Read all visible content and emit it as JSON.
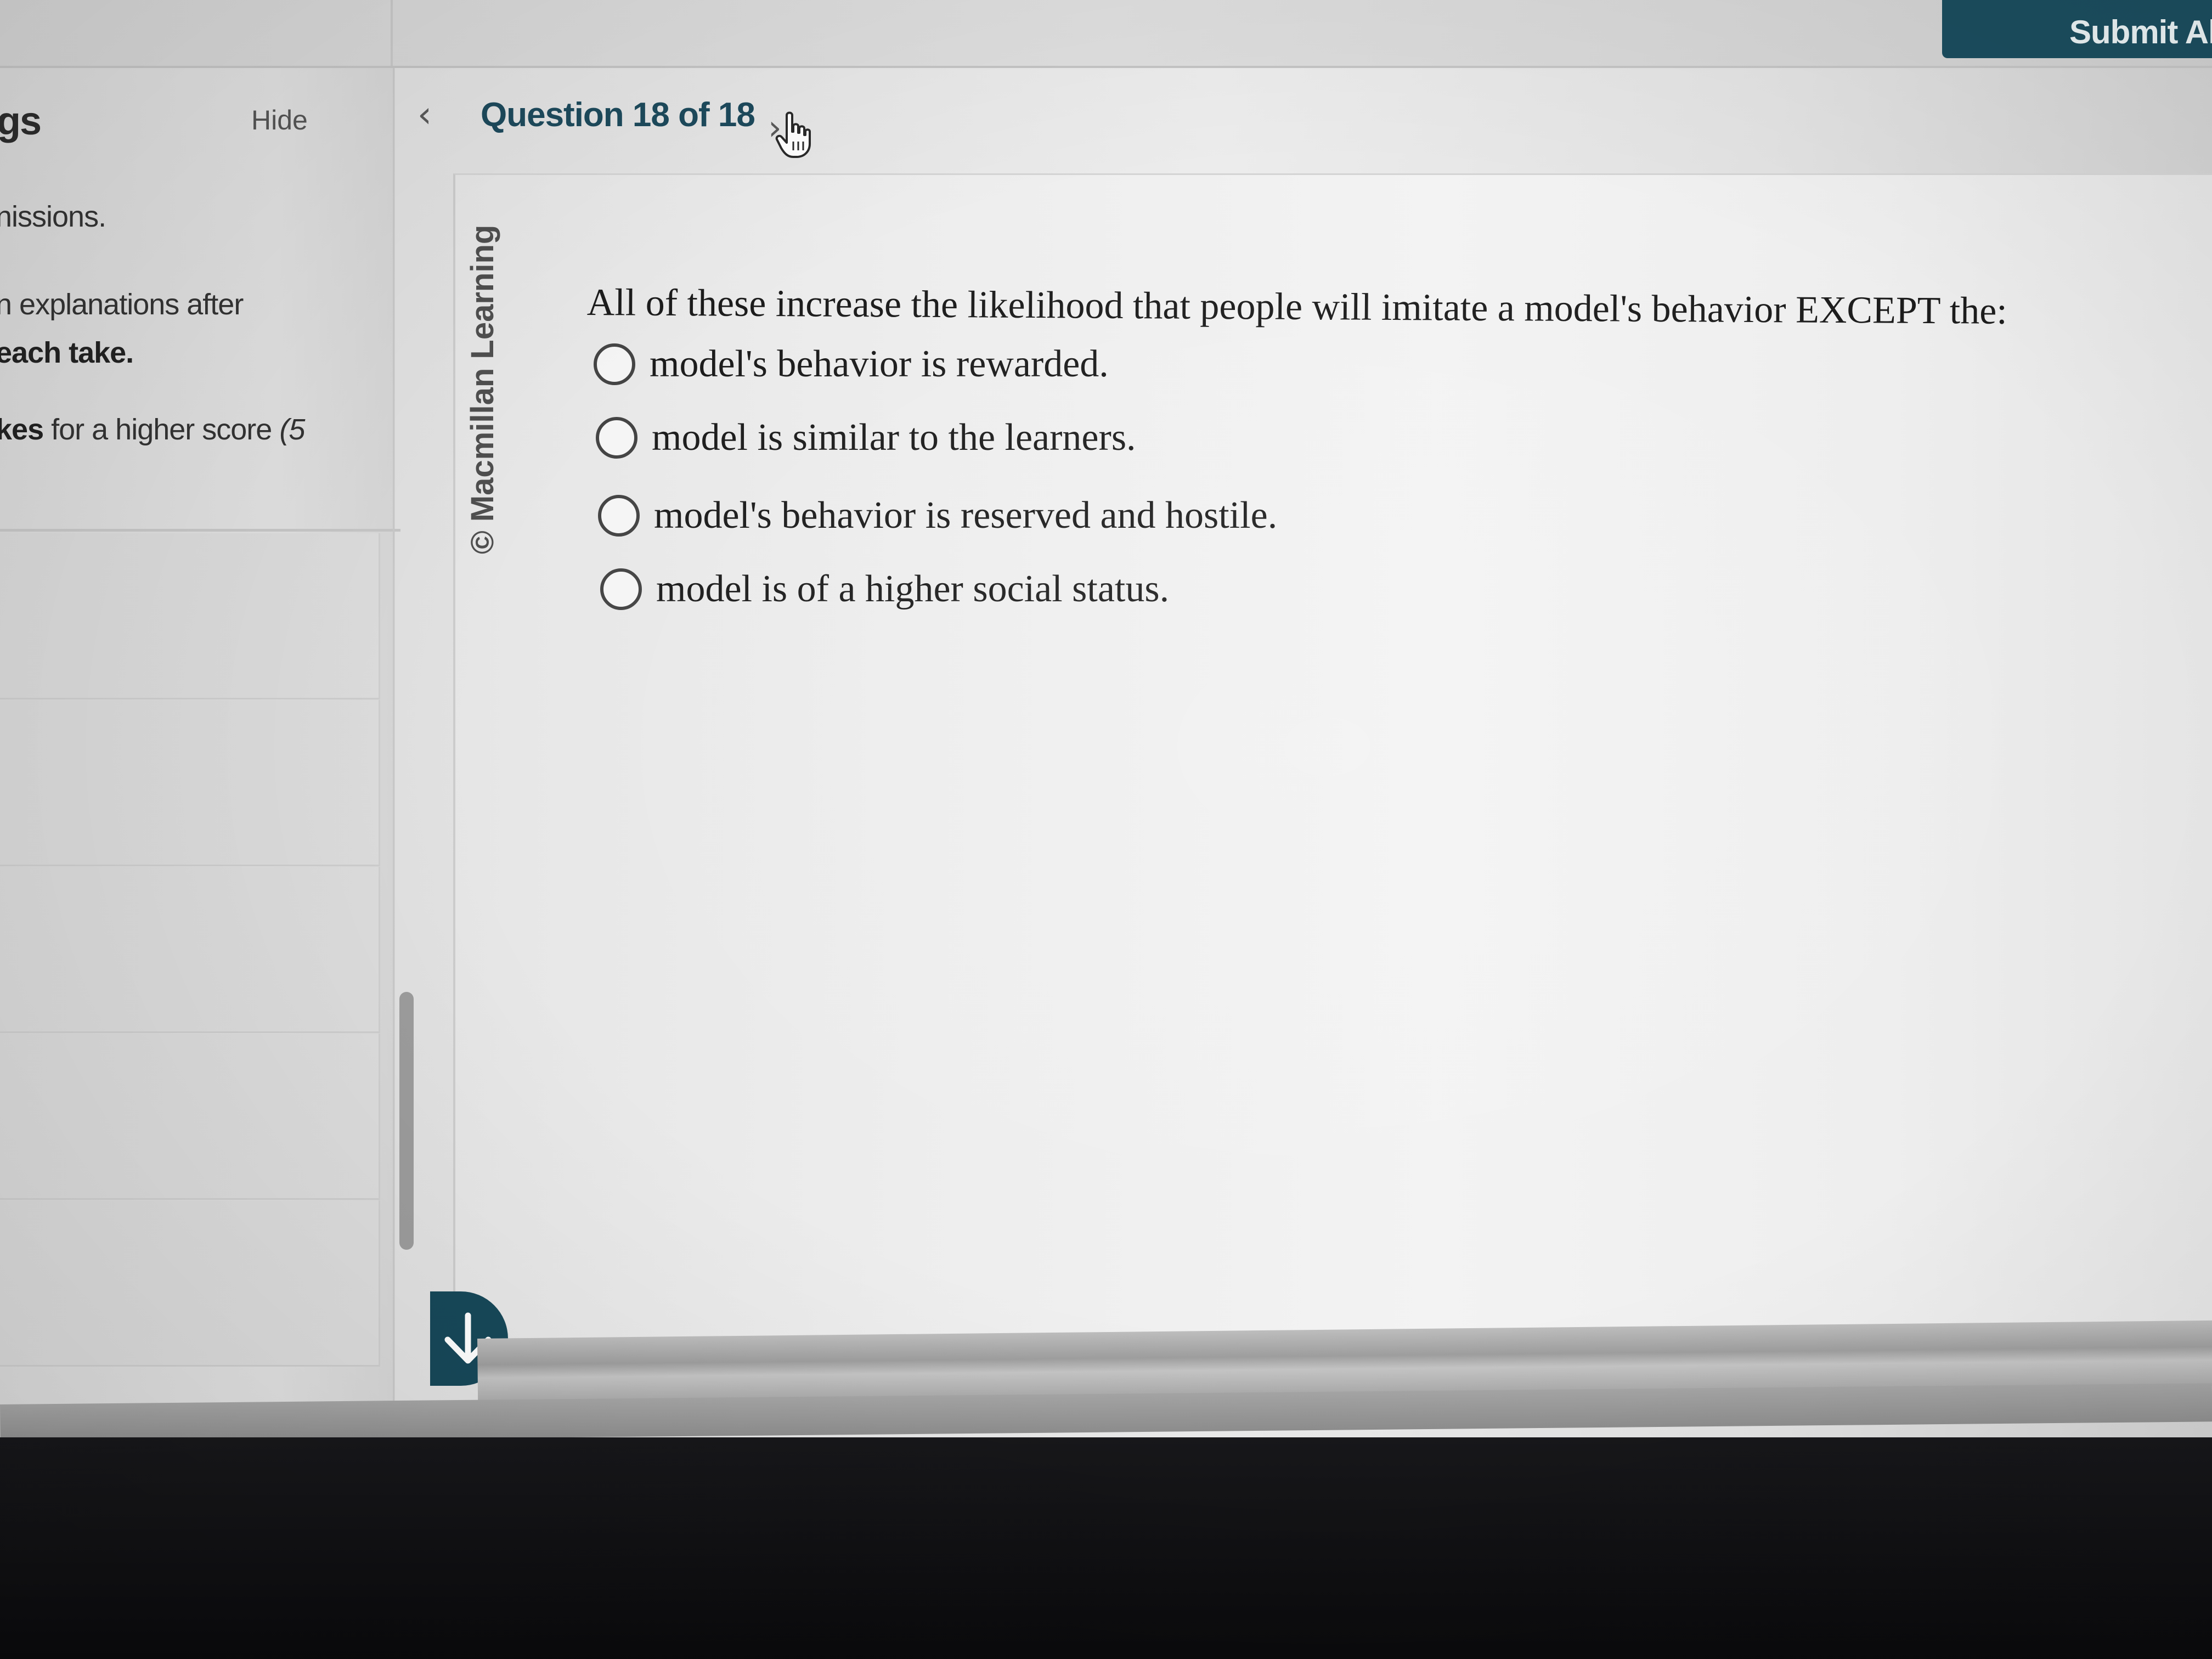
{
  "header": {
    "submit_label": "Submit All"
  },
  "sidebar": {
    "title_fragment": "gs",
    "hide_label": "Hide",
    "lines": [
      {
        "text": "nissions."
      },
      {
        "text": "n explanations after"
      },
      {
        "text": "each take."
      },
      {
        "bold": "kes",
        "text": " for a higher score ",
        "italic": "(5"
      }
    ]
  },
  "navigation": {
    "prev_icon": "chevron-left-icon",
    "counter": "Question 18 of 18",
    "next_icon": "chevron-right-icon"
  },
  "watermark": "© Macmillan Learning",
  "question": {
    "text": "All of these increase the likelihood that people will imitate a model's behavior EXCEPT the:",
    "options": [
      {
        "label": "model's behavior is rewarded.",
        "selected": false
      },
      {
        "label": "model is similar to the learners.",
        "selected": false
      },
      {
        "label": "model's behavior is reserved and hostile.",
        "selected": false
      },
      {
        "label": "model is of a higher social status.",
        "selected": false
      }
    ]
  },
  "colors": {
    "accent": "#1b4d5e",
    "counter_text": "#1d4a5c"
  },
  "icons": {
    "cursor": "hand-pointer-icon",
    "scroll": "arrow-down-icon"
  }
}
